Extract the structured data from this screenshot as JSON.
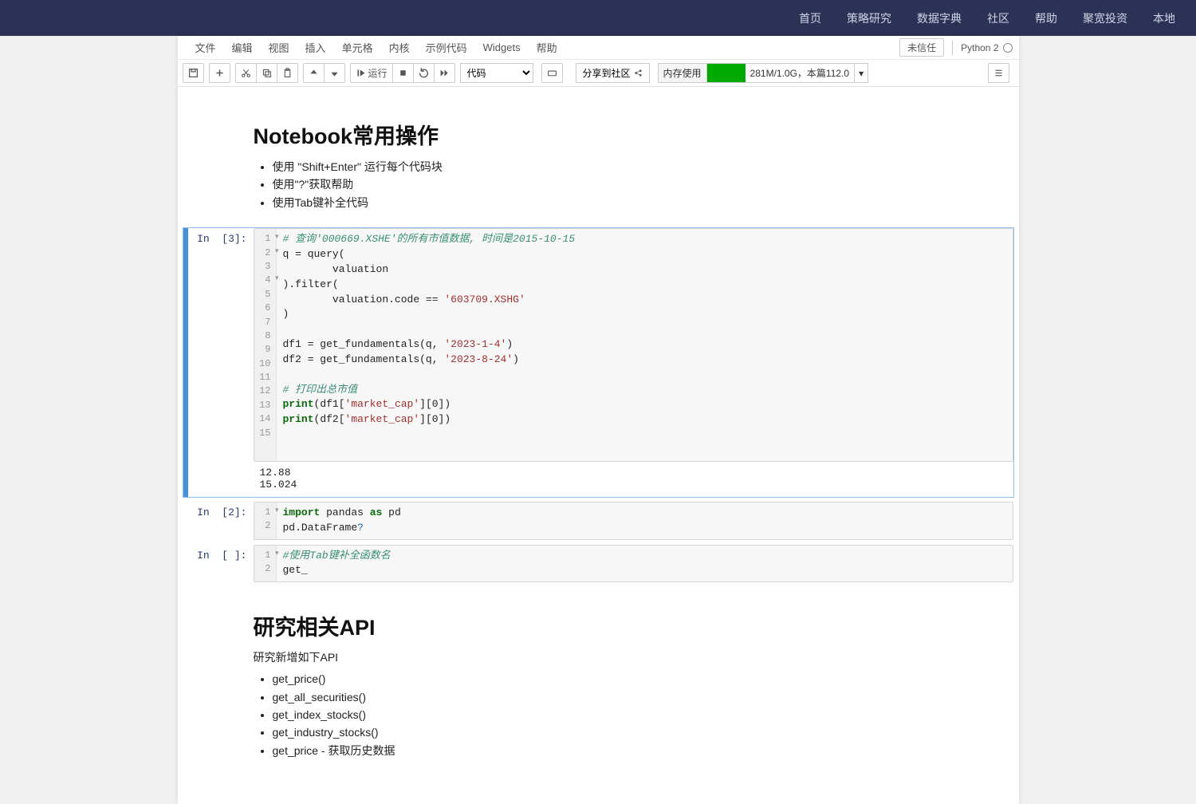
{
  "topnav": {
    "items": [
      "首页",
      "策略研究",
      "数据字典",
      "社区",
      "帮助",
      "聚宽投资",
      "本地"
    ]
  },
  "menubar": {
    "items": [
      "文件",
      "编辑",
      "视图",
      "插入",
      "单元格",
      "内核",
      "示例代码",
      "Widgets",
      "帮助"
    ],
    "trust": "未信任",
    "kernel": "Python 2"
  },
  "toolbar": {
    "run_label": "运行",
    "cell_type": "代码",
    "share_label": "分享到社区",
    "mem_label": "内存使用",
    "mem_text": "281M/1.0G，本篇112.0"
  },
  "notebook": {
    "md1": {
      "title": "Notebook常用操作",
      "bullets": [
        "使用 \"Shift+Enter\" 运行每个代码块",
        "使用\"?\"获取帮助",
        "使用Tab键补全代码"
      ]
    },
    "cell1": {
      "prompt": "In  [3]:",
      "code_lines_html": [
        "<span class='tok-cmt'># 查询'000669.XSHE'的所有市值数据, 时间是2015-10-15</span>",
        "q = query(",
        "        valuation",
        ").filter(",
        "        valuation.code == <span class='tok-str'>'603709.XSHG'</span>",
        ")",
        "",
        "df1 = get_fundamentals(q, <span class='tok-str'>'2023-1-4'</span>)",
        "df2 = get_fundamentals(q, <span class='tok-str'>'2023-8-24'</span>)",
        "",
        "<span class='tok-cmt'># 打印出总市值</span>",
        "<span class='tok-kw'>print</span>(df1[<span class='tok-str'>'market_cap'</span>][0])",
        "<span class='tok-kw'>print</span>(df2[<span class='tok-str'>'market_cap'</span>][0])",
        "",
        ""
      ],
      "output": "12.88\n15.024"
    },
    "cell2": {
      "prompt": "In  [2]:",
      "code_lines_html": [
        "<span class='tok-kw'>import</span> pandas <span class='tok-kw'>as</span> pd",
        "pd.DataFrame<span class='tok-blt'>?</span>"
      ]
    },
    "cell3": {
      "prompt": "In  [ ]:",
      "code_lines_html": [
        "<span class='tok-cmt'>#使用Tab键补全函数名</span>",
        "get_"
      ]
    },
    "md2": {
      "title": "研究相关API",
      "subtitle": "研究新增如下API",
      "bullets": [
        "get_price()",
        "get_all_securities()",
        "get_index_stocks()",
        "get_industry_stocks()",
        "get_price - 获取历史数据"
      ]
    }
  }
}
